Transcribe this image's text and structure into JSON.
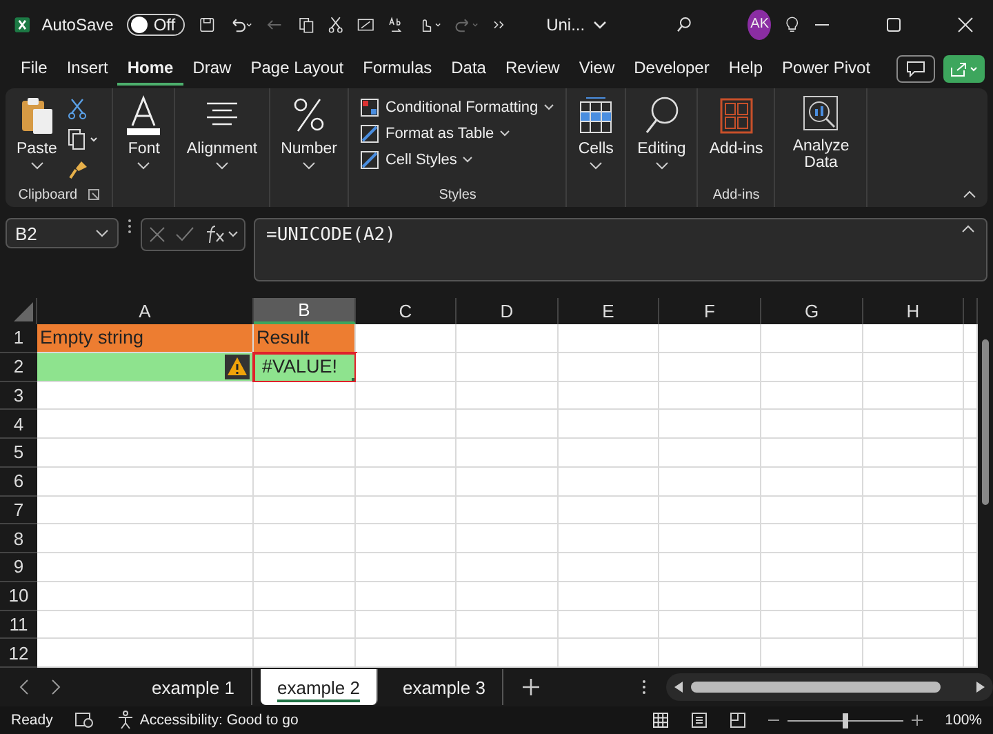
{
  "title_bar": {
    "autosave_label": "AutoSave",
    "autosave_toggle": {
      "label": "Off",
      "on": false
    },
    "file_name": "Uni...",
    "avatar": "AK"
  },
  "menu": [
    {
      "label": "File",
      "selected": false
    },
    {
      "label": "Insert",
      "selected": false
    },
    {
      "label": "Home",
      "selected": true
    },
    {
      "label": "Draw",
      "selected": false
    },
    {
      "label": "Page Layout",
      "selected": false
    },
    {
      "label": "Formulas",
      "selected": false
    },
    {
      "label": "Data",
      "selected": false
    },
    {
      "label": "Review",
      "selected": false
    },
    {
      "label": "View",
      "selected": false
    },
    {
      "label": "Developer",
      "selected": false
    },
    {
      "label": "Help",
      "selected": false
    },
    {
      "label": "Power Pivot",
      "selected": false
    }
  ],
  "ribbon": {
    "clipboard": {
      "paste": "Paste",
      "group": "Clipboard"
    },
    "font": "Font",
    "alignment": "Alignment",
    "number": "Number",
    "styles": {
      "items": [
        "Conditional Formatting",
        "Format as Table",
        "Cell Styles"
      ],
      "group": "Styles"
    },
    "cells": "Cells",
    "editing": "Editing",
    "addins": {
      "button": "Add-ins",
      "group": "Add-ins"
    },
    "analyze": "Analyze Data"
  },
  "formula_bar": {
    "name_box": "B2",
    "formula": "=UNICODE(A2)"
  },
  "sheet": {
    "columns": [
      {
        "label": "A",
        "selected": false
      },
      {
        "label": "B",
        "selected": true
      },
      {
        "label": "C",
        "selected": false
      },
      {
        "label": "D",
        "selected": false
      },
      {
        "label": "E",
        "selected": false
      },
      {
        "label": "F",
        "selected": false
      },
      {
        "label": "G",
        "selected": false
      },
      {
        "label": "H",
        "selected": false
      }
    ],
    "rows": [
      {
        "number": "1",
        "cells": [
          {
            "text": "Empty string",
            "color": "#ed7d31",
            "selected": false
          },
          {
            "text": "Result",
            "color": "#ed7d31",
            "selected": false
          }
        ]
      },
      {
        "number": "2",
        "cells": [
          {
            "color": "#8ee38e",
            "warning": true,
            "selected": false
          },
          {
            "text": "#VALUE!",
            "color": "#8ee38e",
            "selected": true
          }
        ]
      },
      {
        "number": "3"
      },
      {
        "number": "4"
      },
      {
        "number": "5"
      },
      {
        "number": "6"
      },
      {
        "number": "7"
      },
      {
        "number": "8"
      },
      {
        "number": "9"
      },
      {
        "number": "10"
      },
      {
        "number": "11"
      },
      {
        "number": "12"
      }
    ]
  },
  "sheet_tabs": [
    {
      "label": "example 1",
      "selected": false
    },
    {
      "label": "example 2",
      "selected": true
    },
    {
      "label": "example 3",
      "selected": false
    }
  ],
  "status_bar": {
    "status": "Ready",
    "accessibility": "Accessibility: Good to go",
    "zoom": {
      "level": 0.5,
      "reading": "100%"
    }
  }
}
